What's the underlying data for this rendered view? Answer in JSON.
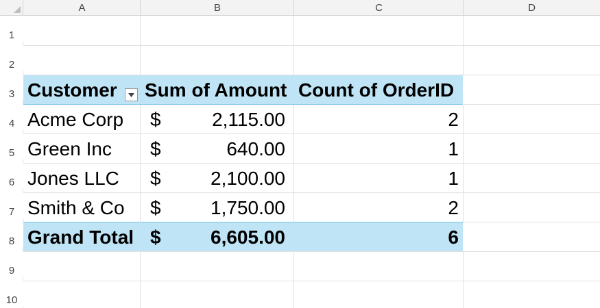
{
  "columns": [
    "A",
    "B",
    "C",
    "D"
  ],
  "rows": [
    "1",
    "2",
    "3",
    "4",
    "5",
    "6",
    "7",
    "8",
    "9",
    "10"
  ],
  "pivot": {
    "headers": {
      "customer": "Customer",
      "sum_amount": "Sum of Amount",
      "count_orderid": "Count of OrderID"
    },
    "currency_symbol": "$",
    "data_rows": [
      {
        "customer": "Acme Corp",
        "amount": "2,115.00",
        "count": "2"
      },
      {
        "customer": "Green Inc",
        "amount": "640.00",
        "count": "1"
      },
      {
        "customer": "Jones LLC",
        "amount": "2,100.00",
        "count": "1"
      },
      {
        "customer": "Smith & Co",
        "amount": "1,750.00",
        "count": "2"
      }
    ],
    "total": {
      "label": "Grand Total",
      "amount": "6,605.00",
      "count": "6"
    }
  },
  "colors": {
    "pivot_band": "#bfe4f5",
    "pivot_band_border": "#7cc3e6",
    "gridline": "#e1e1e1",
    "header_bg": "#f3f3f3"
  },
  "icons": {
    "filter": "filter-dropdown-icon",
    "select_all": "select-all-triangle-icon"
  }
}
